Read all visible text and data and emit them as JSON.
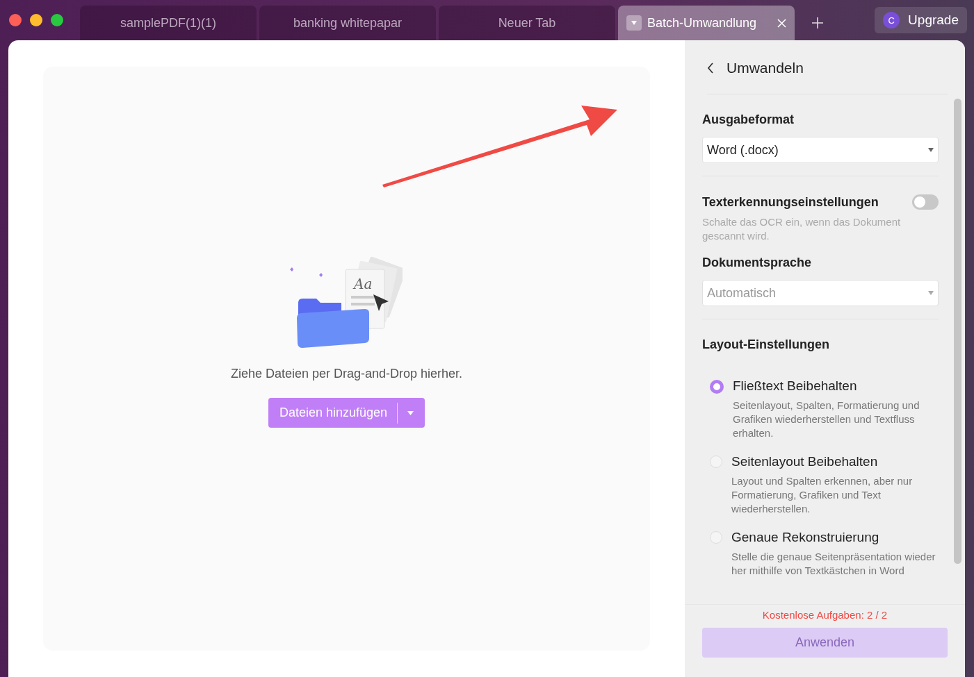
{
  "tabs": [
    {
      "label": "samplePDF(1)(1)",
      "selected": false
    },
    {
      "label": "banking whitepapar",
      "selected": false
    },
    {
      "label": "Neuer Tab",
      "selected": false
    },
    {
      "label": "Batch-Umwandlung",
      "selected": true
    }
  ],
  "upgrade": {
    "avatar": "C",
    "label": "Upgrade"
  },
  "dropzone": {
    "illustration_text": "Aa",
    "hint": "Ziehe Dateien per Drag-and-Drop hierher.",
    "button": "Dateien hinzufügen"
  },
  "panel": {
    "title": "Umwandeln",
    "output_format": {
      "label": "Ausgabeformat",
      "value": "Word (.docx)"
    },
    "ocr": {
      "label": "Texterkennungseinstellungen",
      "on": false,
      "hint": "Schalte das OCR ein, wenn das Dokument gescannt wird."
    },
    "language": {
      "label": "Dokumentsprache",
      "value": "Automatisch",
      "disabled": true
    },
    "layout": {
      "label": "Layout-Einstellungen",
      "options": [
        {
          "title": "Fließtext Beibehalten",
          "description": "Seitenlayout, Spalten, Formatierung und Grafiken wiederherstellen und Textfluss erhalten.",
          "selected": true
        },
        {
          "title": "Seitenlayout Beibehalten",
          "description": "Layout und Spalten erkennen, aber nur Formatierung, Grafiken und Text wiederherstellen.",
          "selected": false
        },
        {
          "title": "Genaue Rekonstruierung",
          "description": "Stelle die genaue Seitenpräsentation wieder her mithilfe von Textkästchen in Word",
          "selected": false
        }
      ]
    },
    "free_tasks": "Kostenlose Aufgaben: 2 / 2",
    "apply": {
      "label": "Anwenden",
      "disabled": true
    }
  }
}
